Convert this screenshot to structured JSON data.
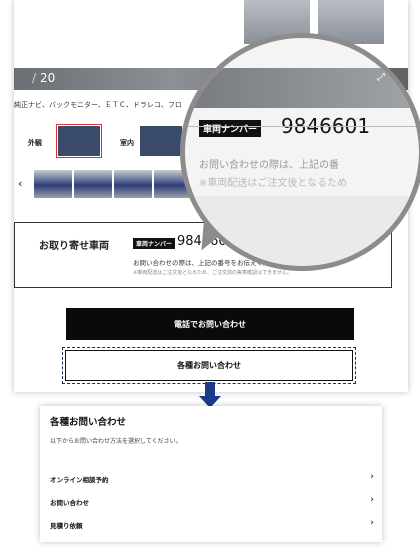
{
  "listing": {
    "photo_counter": "20",
    "equipment_text": "純正ナビ、バックモニター、ＥＴＣ、ドラレコ、フロ",
    "views": [
      {
        "label": "外観"
      },
      {
        "label": "室内"
      }
    ],
    "order": {
      "title": "お取り寄せ車両",
      "number_tag": "車両ナンバー",
      "number": "9846601",
      "note": "お問い合わせの際は、上記の番号をお伝えください。",
      "small": "※車両配送はご注文後となるため、ご注文前の実車確認はできません。"
    },
    "buttons": {
      "phone": "電話でお問い合わせ",
      "contact": "各種お問い合わせ"
    }
  },
  "magnifier": {
    "number_tag": "車両ナンバー",
    "number": "9846601",
    "note": "お問い合わせの際は、上記の番",
    "small": "※車両配送はご注文後となるため"
  },
  "contact_panel": {
    "title": "各種お問い合わせ",
    "subtitle": "以下からお問い合わせ方法を選択してください。",
    "items": [
      {
        "label": "オンライン相談予約"
      },
      {
        "label": "お問い合わせ"
      },
      {
        "label": "見積り依頼"
      }
    ]
  },
  "colors": {
    "arrow": "#1b3a8a",
    "button_dark": "#0a0a0a",
    "car_blue": "#2e3f78"
  }
}
